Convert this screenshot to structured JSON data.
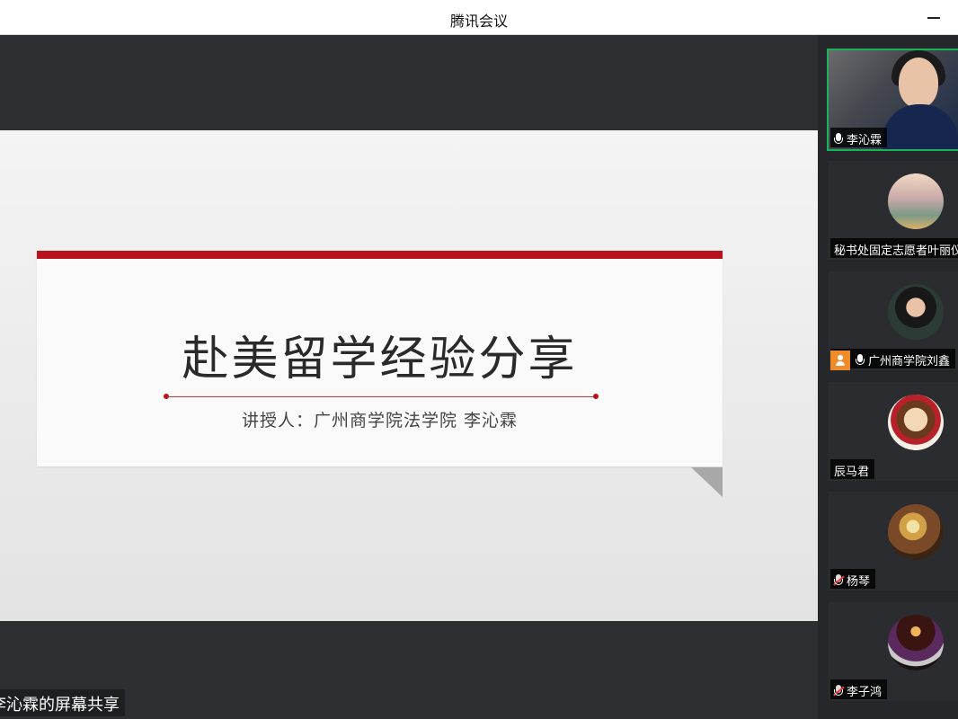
{
  "window": {
    "title": "腾讯会议"
  },
  "slide": {
    "title": "赴美留学经验分享",
    "subtitle": "讲授人：广州商学院法学院 李沁霖"
  },
  "share": {
    "label": "李沁霖的屏幕共享"
  },
  "participants": [
    {
      "name": "李沁霖",
      "mic": "on",
      "video": true,
      "active": true
    },
    {
      "name": "秘书处固定志愿者叶丽仪",
      "mic": "none",
      "video": false
    },
    {
      "name": "广州商学院刘鑫",
      "mic": "on",
      "video": false,
      "host": true
    },
    {
      "name": "辰马君",
      "mic": "none",
      "video": false
    },
    {
      "name": "杨琴",
      "mic": "muted",
      "video": false
    },
    {
      "name": "李子鸿",
      "mic": "muted",
      "video": false
    }
  ],
  "colors": {
    "accent_red": "#b7121d",
    "active_border": "#1bb35a",
    "host_orange": "#f08b2a",
    "muted_red": "#e5393b"
  },
  "icons": {
    "minimize": "minimize-icon",
    "mic": "microphone-icon",
    "mic_muted": "microphone-muted-icon",
    "host": "host-user-icon"
  }
}
